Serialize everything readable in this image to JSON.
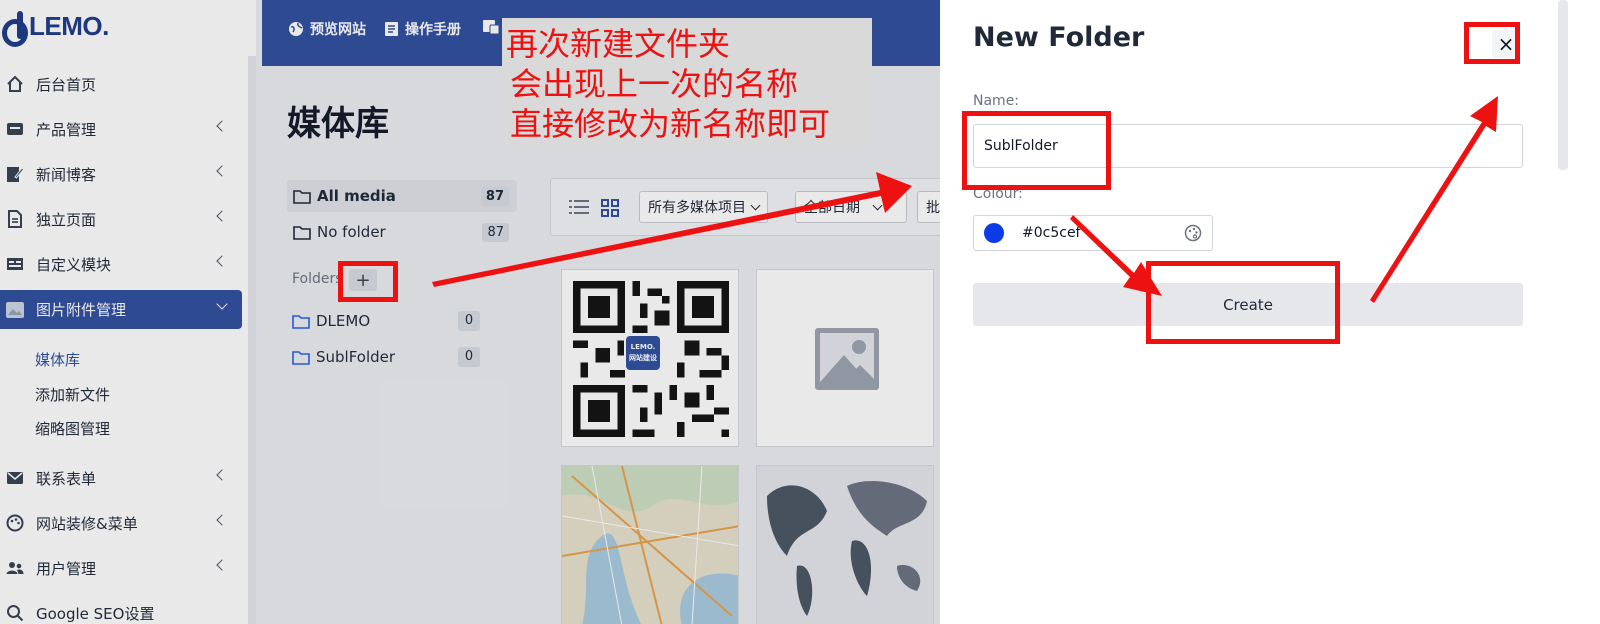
{
  "logo": {
    "text": "LEMO."
  },
  "sidebar": {
    "items": [
      {
        "label": "后台首页",
        "icon": "home-icon"
      },
      {
        "label": "产品管理",
        "icon": "box-icon"
      },
      {
        "label": "新闻博客",
        "icon": "edit-icon"
      },
      {
        "label": "独立页面",
        "icon": "page-icon"
      },
      {
        "label": "自定义模块",
        "icon": "module-icon"
      },
      {
        "label": "图片附件管理",
        "icon": "image-icon"
      },
      {
        "label": "联系表单",
        "icon": "mail-icon"
      },
      {
        "label": "网站装修&菜单",
        "icon": "palette-icon"
      },
      {
        "label": "用户管理",
        "icon": "users-icon"
      },
      {
        "label": "Google SEO设置",
        "icon": "search-icon"
      }
    ],
    "subitems": [
      "媒体库",
      "添加新文件",
      "缩略图管理"
    ]
  },
  "topbar": {
    "links": [
      "预览网站",
      "操作手册"
    ]
  },
  "main": {
    "title": "媒体库",
    "all_media": {
      "label": "All media",
      "count": "87"
    },
    "no_folder": {
      "label": "No folder",
      "count": "87"
    },
    "folders_label": "Folders",
    "add_folder": "+",
    "folders": [
      {
        "name": "DLEMO",
        "count": "0"
      },
      {
        "name": "SublFolder",
        "count": "0"
      }
    ],
    "filter_type": "所有多媒体项目",
    "filter_date": "全部日期",
    "bulk_label": "批",
    "qr_label_top": "LEMO.",
    "qr_label_bottom": "网站建设"
  },
  "annotation": {
    "lines": [
      "再次新建文件夹",
      "会出现上一次的名称",
      "直接修改为新名称即可"
    ],
    "color": "#ee1111"
  },
  "modal": {
    "title": "New Folder",
    "close": "×",
    "name_label": "Name:",
    "name_value": "SublFolder",
    "colour_label": "Colour:",
    "colour_value": "#0c5cef",
    "swatch_color": "#0c3ce8",
    "create_label": "Create"
  },
  "colors": {
    "brand": "#2e4f9e",
    "annotation_red": "#ee1111"
  }
}
